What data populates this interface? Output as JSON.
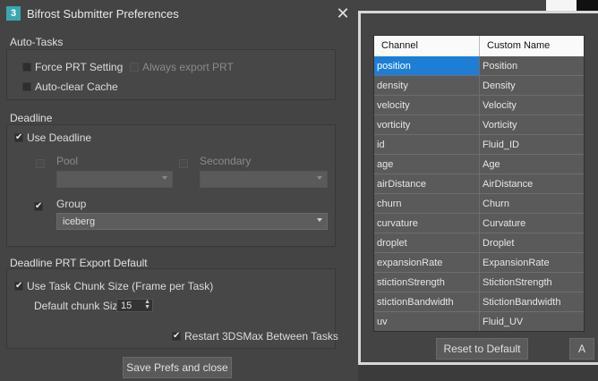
{
  "window": {
    "title": "Bifrost Submitter Preferences",
    "icon": "3ds-max-app-icon",
    "close_glyph": "✕",
    "icon_text": "3"
  },
  "auto_tasks": {
    "title": "Auto-Tasks",
    "force_prt": {
      "label": "Force PRT Setting",
      "checked": false
    },
    "always_export": {
      "label": "Always export PRT",
      "checked": false,
      "disabled": true
    },
    "auto_clear": {
      "label": "Auto-clear Cache",
      "checked": false
    }
  },
  "deadline": {
    "title": "Deadline",
    "use_deadline": {
      "label": "Use Deadline",
      "checked": true
    },
    "pool": {
      "label": "Pool",
      "value": "",
      "checked": false,
      "disabled": true
    },
    "secondary": {
      "label": "Secondary",
      "value": "",
      "checked": false,
      "disabled": true
    },
    "group": {
      "label": "Group",
      "value": "iceberg",
      "checked": true
    }
  },
  "prt_export": {
    "title": "Deadline PRT Export Default",
    "use_chunk": {
      "label": "Use Task Chunk Size (Frame per Task)",
      "checked": true
    },
    "chunk_label": "Default chunk Size",
    "chunk_value": "15",
    "restart": {
      "label": "Restart 3DSMax Between Tasks",
      "checked": true
    }
  },
  "save_button": "Save Prefs and close",
  "channels": {
    "headers": [
      "Channel",
      "Custom Name"
    ],
    "rows": [
      [
        "position",
        "Position"
      ],
      [
        "density",
        "Density"
      ],
      [
        "velocity",
        "Velocity"
      ],
      [
        "vorticity",
        "Vorticity"
      ],
      [
        "id",
        "Fluid_ID"
      ],
      [
        "age",
        "Age"
      ],
      [
        "airDistance",
        "AirDistance"
      ],
      [
        "churn",
        "Churn"
      ],
      [
        "curvature",
        "Curvature"
      ],
      [
        "droplet",
        "Droplet"
      ],
      [
        "expansionRate",
        "ExpansionRate"
      ],
      [
        "stictionStrength",
        "StictionStrength"
      ],
      [
        "stictionBandwidth",
        "StictionBandwidth"
      ],
      [
        "uv",
        "Fluid_UV"
      ]
    ],
    "selected_row": 0,
    "reset_button": "Reset to Default",
    "a_button": "A"
  },
  "colors": {
    "background": "#444444",
    "selection": "#1e7ed6"
  }
}
